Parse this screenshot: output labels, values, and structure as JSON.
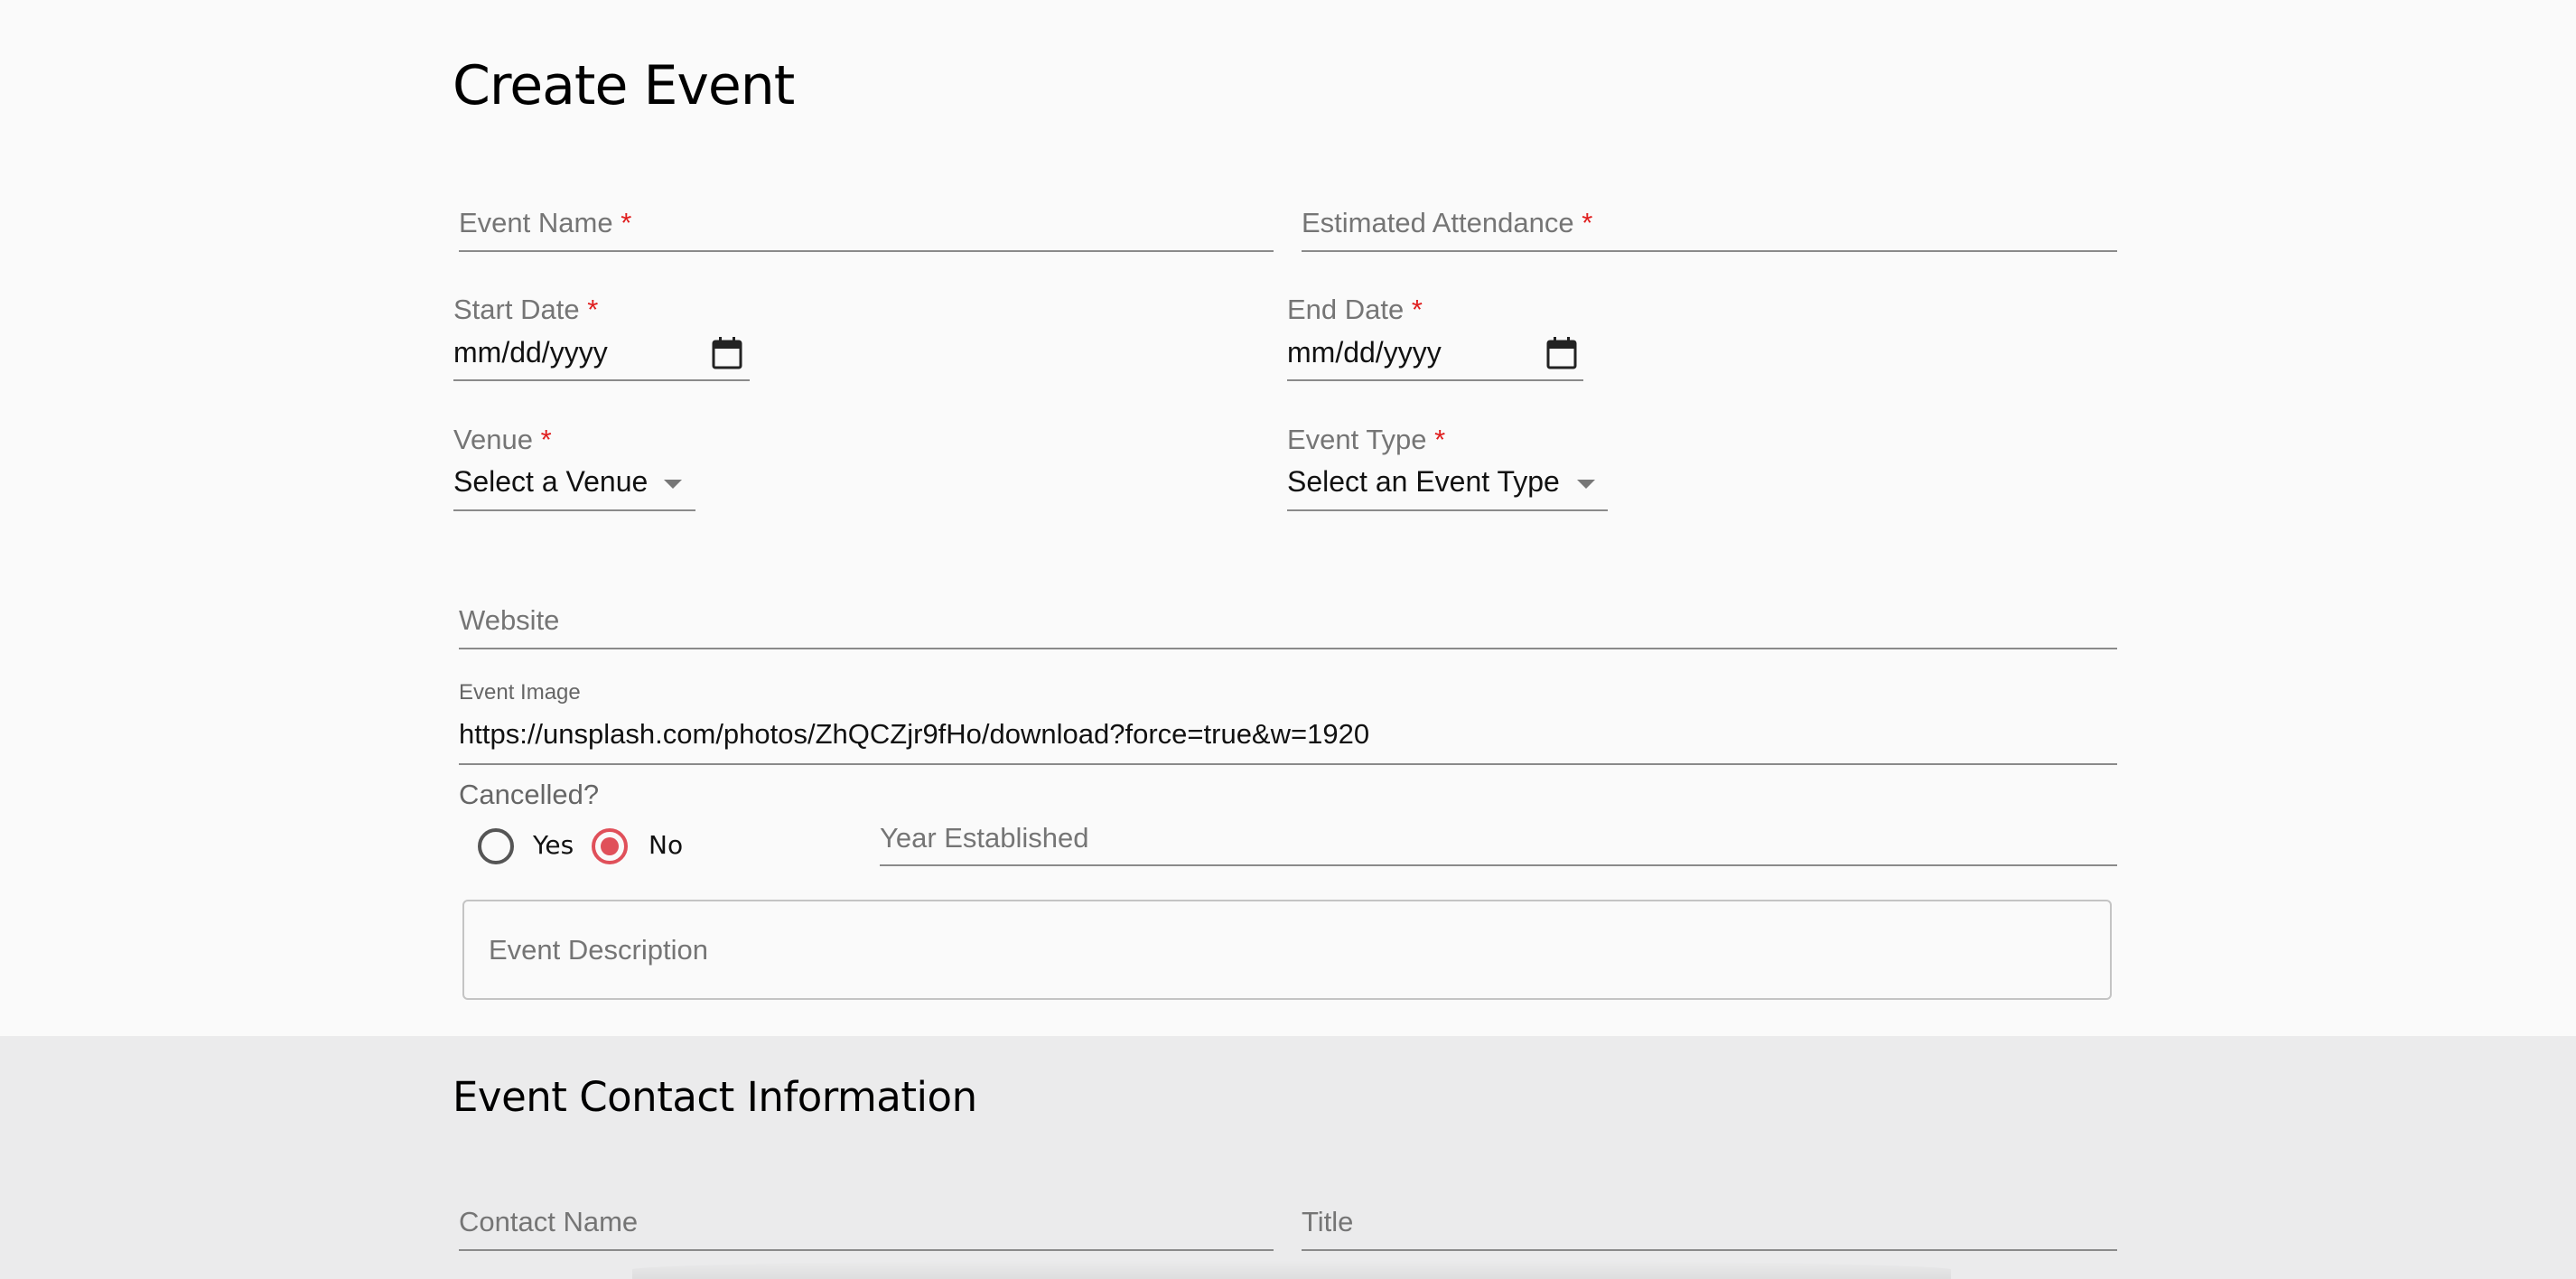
{
  "form": {
    "title": "Create Event",
    "required_mark": "*",
    "event_name": {
      "label": "Event Name",
      "value": ""
    },
    "estimated_attendance": {
      "label": "Estimated Attendance",
      "value": ""
    },
    "start_date": {
      "label": "Start Date",
      "placeholder": "mm/dd/yyyy"
    },
    "end_date": {
      "label": "End Date",
      "placeholder": "mm/dd/yyyy"
    },
    "venue": {
      "label": "Venue",
      "selected": "Select a Venue"
    },
    "event_type": {
      "label": "Event Type",
      "selected": "Select an Event Type"
    },
    "website": {
      "label": "Website",
      "value": ""
    },
    "event_image": {
      "label": "Event Image",
      "value": "https://unsplash.com/photos/ZhQCZjr9fHo/download?force=true&w=1920"
    },
    "cancelled": {
      "label": "Cancelled?",
      "options": [
        "Yes",
        "No"
      ],
      "selected": "No"
    },
    "year_established": {
      "label": "Year Established",
      "value": ""
    },
    "event_description": {
      "label": "Event Description",
      "value": ""
    }
  },
  "contact": {
    "title": "Event Contact Information",
    "contact_name": {
      "label": "Contact Name",
      "value": ""
    },
    "contact_title": {
      "label": "Title",
      "value": ""
    }
  },
  "colors": {
    "background": "#fafafa",
    "lower_section": "#ebebec",
    "required": "#e01e1e",
    "radio_accent": "#e0505a"
  },
  "icons": {
    "date_picker": "calendar-icon",
    "dropdown": "caret-down-icon"
  }
}
